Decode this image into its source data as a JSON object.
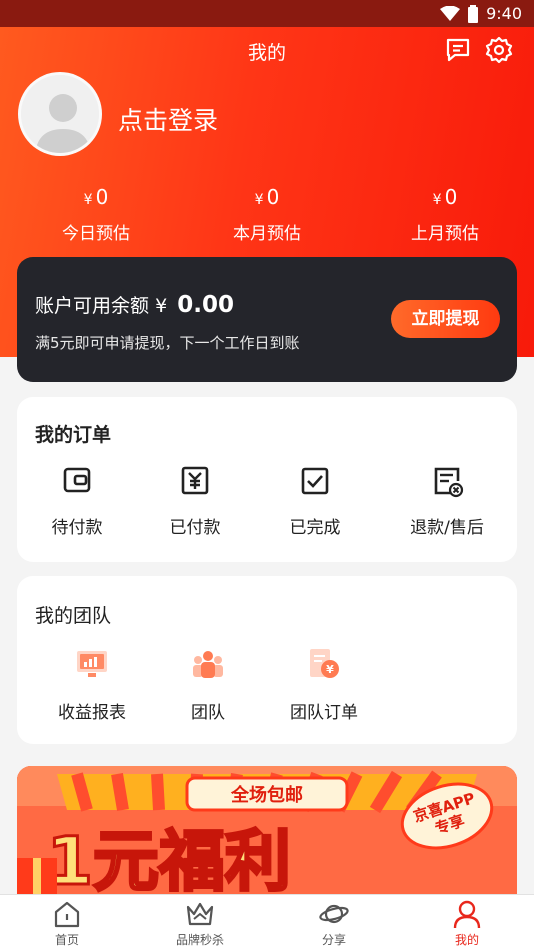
{
  "status_bar": {
    "time": "9:40"
  },
  "header": {
    "title": "我的",
    "login_text": "点击登录",
    "stats": [
      {
        "currency": "¥",
        "value": "0",
        "label": "今日预估"
      },
      {
        "currency": "¥",
        "value": "0",
        "label": "本月预估"
      },
      {
        "currency": "¥",
        "value": "0",
        "label": "上月预估"
      }
    ]
  },
  "balance": {
    "label": "账户可用余额",
    "currency": "¥",
    "amount": "0.00",
    "note": "满5元即可申请提现，下一个工作日到账",
    "withdraw_label": "立即提现"
  },
  "orders": {
    "title": "我的订单",
    "items": [
      {
        "label": "待付款",
        "icon": "wallet-icon"
      },
      {
        "label": "已付款",
        "icon": "paid-receipt-icon"
      },
      {
        "label": "已完成",
        "icon": "check-box-icon"
      },
      {
        "label": "退款/售后",
        "icon": "refund-icon"
      }
    ]
  },
  "team": {
    "title": "我的团队",
    "items": [
      {
        "label": "收益报表",
        "icon": "report-chart-icon"
      },
      {
        "label": "团队",
        "icon": "team-icon"
      },
      {
        "label": "团队订单",
        "icon": "team-order-icon"
      }
    ]
  },
  "banner": {
    "tag": "全场包邮",
    "headline": "1元福利",
    "badge_line1": "京喜APP",
    "badge_line2": "专享"
  },
  "tabbar": {
    "items": [
      {
        "label": "首页",
        "icon": "home-icon",
        "active": false
      },
      {
        "label": "品牌秒杀",
        "icon": "crown-icon",
        "active": false
      },
      {
        "label": "分享",
        "icon": "planet-icon",
        "active": false
      },
      {
        "label": "我的",
        "icon": "user-icon",
        "active": true
      }
    ]
  },
  "colors": {
    "accent": "#ff3516",
    "card_dark": "#24252b",
    "tab_active": "#e8271c"
  }
}
